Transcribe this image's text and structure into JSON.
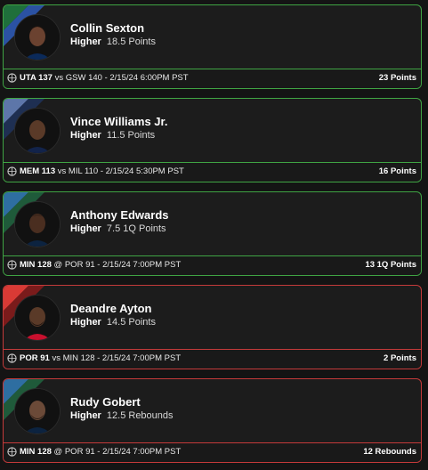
{
  "picks": [
    {
      "player": "Collin Sexton",
      "direction": "Higher",
      "line": "18.5 Points",
      "team_score": "UTA 137",
      "separator": "vs",
      "opponent_score": "GSW 140",
      "datetime": "- 2/15/24 6:00PM PST",
      "result": "23 Points",
      "status": "win",
      "stripe_colors": [
        "#1f6f3b",
        "#2b52a3"
      ],
      "jersey_color": "#0b2a5a"
    },
    {
      "player": "Vince Williams Jr.",
      "direction": "Higher",
      "line": "11.5 Points",
      "team_score": "MEM 113",
      "separator": "vs",
      "opponent_score": "MIL 110",
      "datetime": "- 2/15/24 5:30PM PST",
      "result": "16 Points",
      "status": "win",
      "stripe_colors": [
        "#5d76a9",
        "#1e2f52"
      ],
      "jersey_color": "#12234a"
    },
    {
      "player": "Anthony Edwards",
      "direction": "Higher",
      "line": "7.5 1Q Points",
      "team_score": "MIN 128",
      "separator": "@",
      "opponent_score": "POR 91",
      "datetime": "- 2/15/24 7:00PM PST",
      "result": "13 1Q Points",
      "status": "win",
      "stripe_colors": [
        "#2e6ea1",
        "#1f5a3a"
      ],
      "jersey_color": "#0c2340"
    },
    {
      "player": "Deandre Ayton",
      "direction": "Higher",
      "line": "14.5 Points",
      "team_score": "POR 91",
      "separator": "vs",
      "opponent_score": "MIN 128",
      "datetime": "- 2/15/24 7:00PM PST",
      "result": "2 Points",
      "status": "loss",
      "stripe_colors": [
        "#d93a35",
        "#7a1b1b"
      ],
      "jersey_color": "#c8102e"
    },
    {
      "player": "Rudy Gobert",
      "direction": "Higher",
      "line": "12.5 Rebounds",
      "team_score": "MIN 128",
      "separator": "@",
      "opponent_score": "POR 91",
      "datetime": "- 2/15/24 7:00PM PST",
      "result": "12 Rebounds",
      "status": "loss",
      "stripe_colors": [
        "#2e6ea1",
        "#1f5a3a"
      ],
      "jersey_color": "#0c2340"
    }
  ],
  "colors": {
    "win": "#3fa443",
    "loss": "#c43a3a"
  },
  "icons": {
    "footer": "basketball-icon"
  }
}
